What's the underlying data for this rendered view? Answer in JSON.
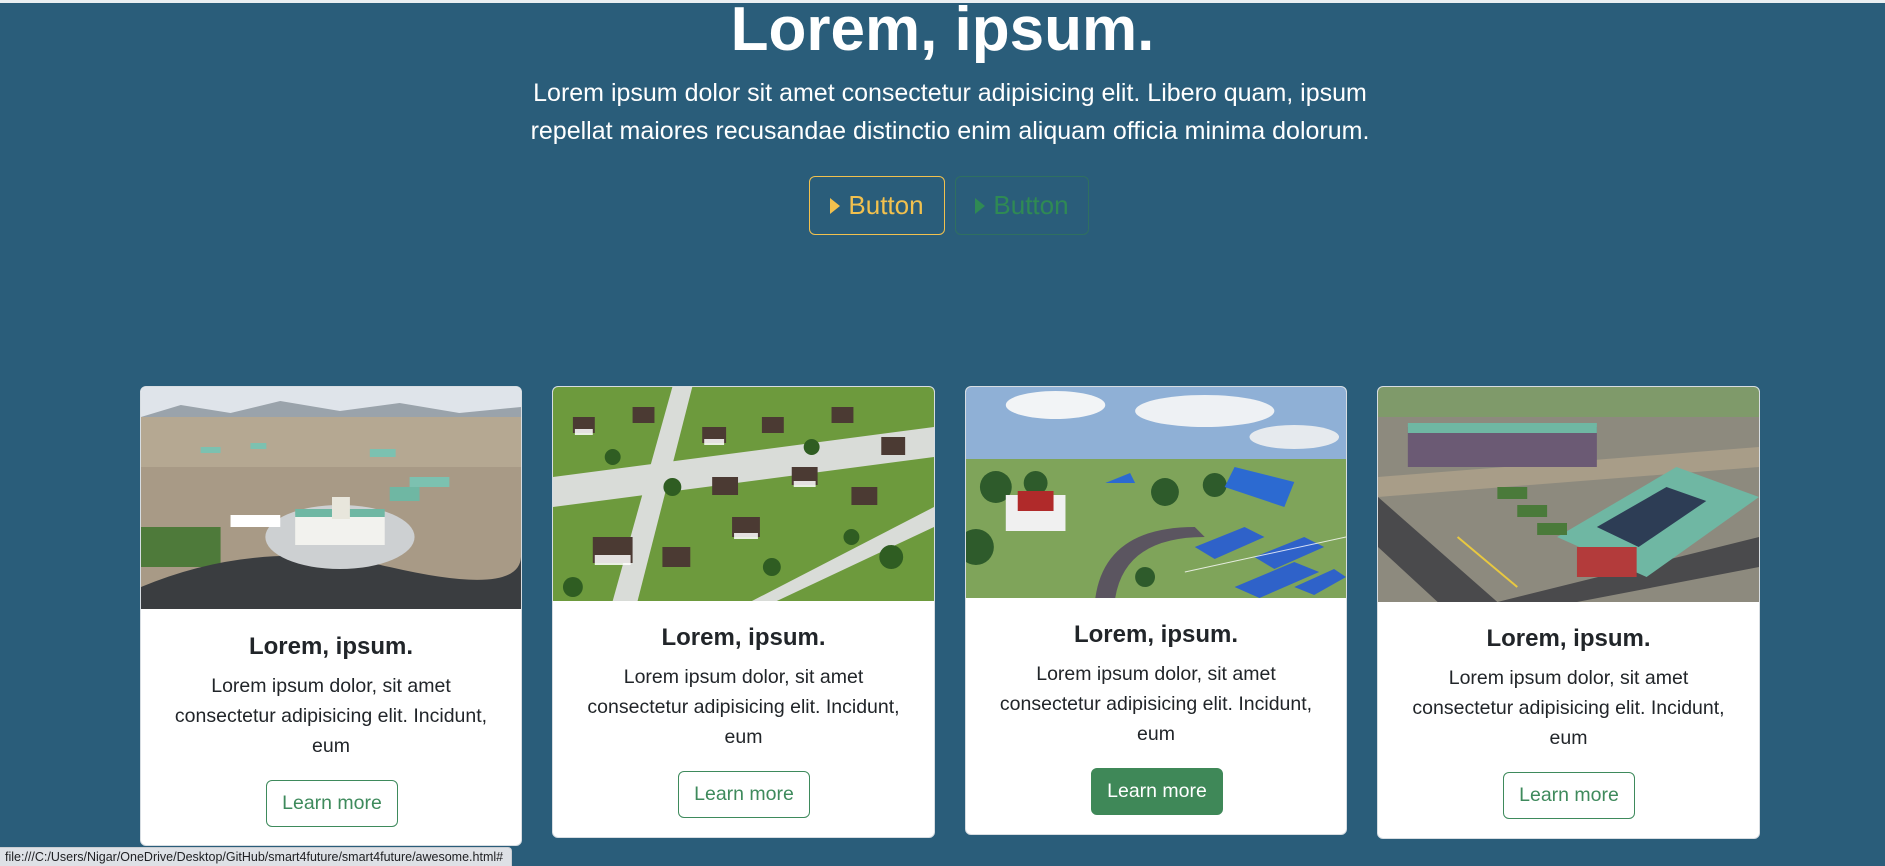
{
  "hero": {
    "title": "Lorem, ipsum.",
    "subtitle": "Lorem ipsum dolor sit amet consectetur adipisicing elit. Libero quam, ipsum repellat maiores recusandae distinctio enim aliquam officia minima dolorum.",
    "buttons": [
      {
        "label": "Button",
        "icon": "play-icon",
        "color": "#f2c14e"
      },
      {
        "label": "Button",
        "icon": "play-icon",
        "color": "#2f8a54"
      }
    ]
  },
  "cards": [
    {
      "image": "aerial-campus-construction-image",
      "title": "Lorem, ipsum.",
      "text": "Lorem ipsum dolor, sit amet consectetur adipisicing elit. Incidunt, eum",
      "button": "Learn more"
    },
    {
      "image": "aerial-village-houses-image",
      "title": "Lorem, ipsum.",
      "text": "Lorem ipsum dolor, sit amet consectetur adipisicing elit. Incidunt, eum",
      "button": "Learn more"
    },
    {
      "image": "solar-panel-village-image",
      "title": "Lorem, ipsum.",
      "text": "Lorem ipsum dolor, sit amet consectetur adipisicing elit. Incidunt, eum",
      "button": "Learn more"
    },
    {
      "image": "aerial-solar-school-image",
      "title": "Lorem, ipsum.",
      "text": "Lorem ipsum dolor, sit amet consectetur adipisicing elit. Incidunt, eum",
      "button": "Learn more"
    }
  ],
  "status_bar": {
    "url": "file:///C:/Users/Nigar/OneDrive/Desktop/GitHub/smart4future/smart4future/awesome.html#"
  },
  "colors": {
    "background": "#2a5d7a",
    "accent_yellow": "#f2c14e",
    "accent_green": "#3e8a5c",
    "card": "#ffffff"
  }
}
